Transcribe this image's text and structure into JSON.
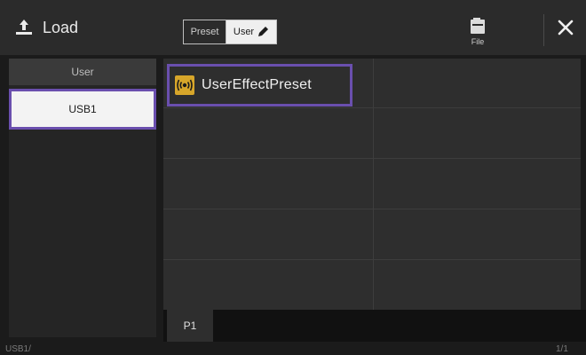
{
  "header": {
    "title": "Load",
    "load_icon": "load-arrow-icon",
    "segment": {
      "preset_label": "Preset",
      "user_label": "User",
      "user_edit_icon": "pencil-icon",
      "selected": "User"
    },
    "file_button": {
      "label": "File",
      "icon": "file-folder-icon"
    },
    "close_icon": "close-icon"
  },
  "sidebar": {
    "items": [
      {
        "label": "User",
        "selected": false
      },
      {
        "label": "USB1",
        "selected": true
      }
    ]
  },
  "grid": {
    "items": [
      {
        "label": "UserEffectPreset",
        "icon": "effect-wave-icon",
        "selected": true
      }
    ],
    "tabs": [
      {
        "label": "P1",
        "active": true
      }
    ]
  },
  "status": {
    "path": "USB1/",
    "page": "1/1"
  },
  "colors": {
    "selection_accent": "#6a4fae",
    "icon_gold": "#d7a62a",
    "background": "#1b1b1b",
    "grid_bg": "#2e2e2e"
  }
}
